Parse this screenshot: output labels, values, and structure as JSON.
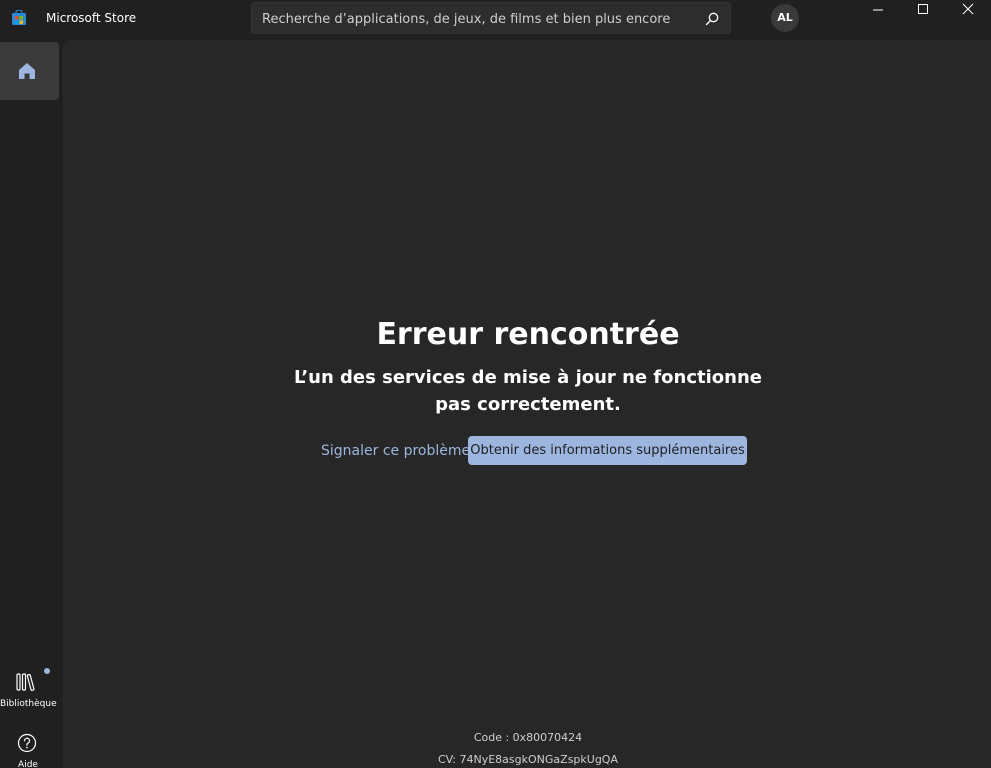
{
  "app": {
    "title": "Microsoft Store"
  },
  "search": {
    "placeholder": "Recherche d’applications, de jeux, de films et bien plus encore"
  },
  "user": {
    "initials": "AL"
  },
  "sidebar": {
    "items": [
      {
        "label": "",
        "icon": "home-icon",
        "active": true
      },
      {
        "label": "Bibliothèque",
        "icon": "library-icon"
      },
      {
        "label": "Aide",
        "icon": "help-icon"
      }
    ]
  },
  "error": {
    "title": "Erreur rencontrée",
    "message": "L’un des services de mise à jour ne fonctionne pas correctement.",
    "report_link": "Signaler ce problème",
    "more_info_button": "Obtenir des informations supplémentaires",
    "code": "Code : 0x80070424",
    "cv": "CV: 74NyE8asgkONGaZspkUgQA"
  },
  "colors": {
    "accent": "#9db6e0",
    "background": "#202020",
    "content_background": "#272727"
  }
}
